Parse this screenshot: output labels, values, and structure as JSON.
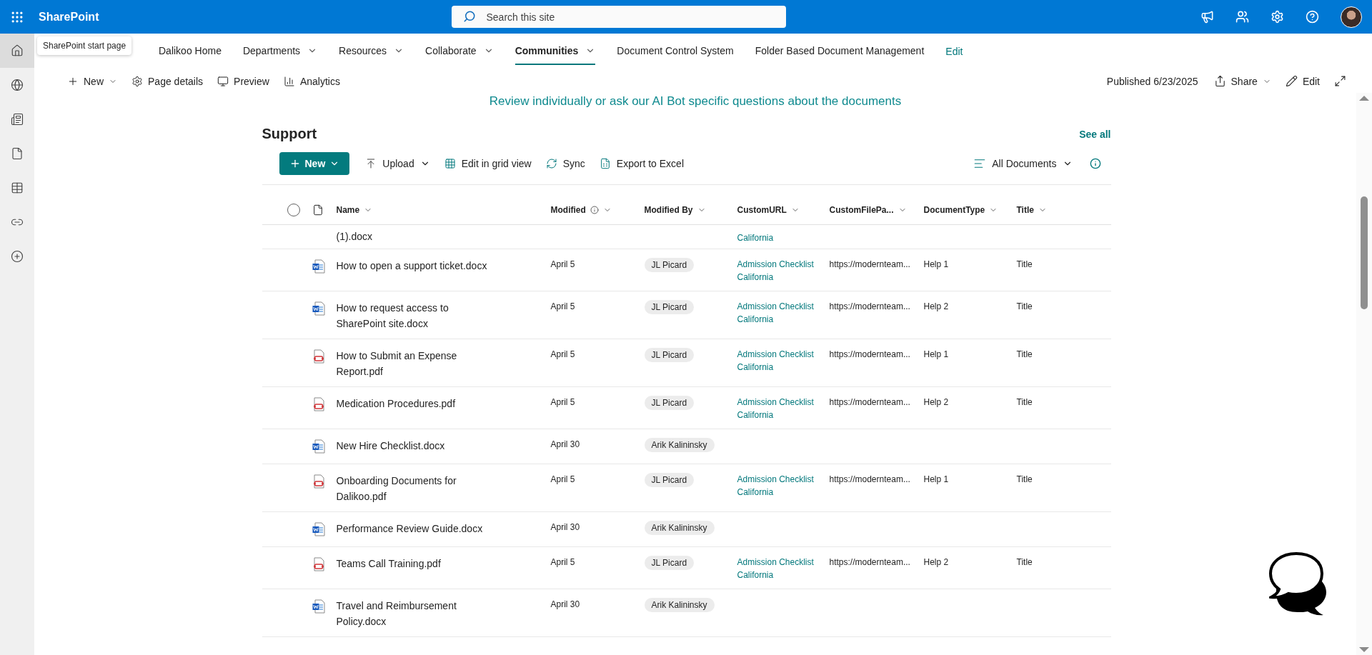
{
  "app_bar": {
    "title": "SharePoint",
    "search": {
      "placeholder": "Search this site"
    },
    "actions": [
      {
        "kind": "megaphone"
      },
      {
        "kind": "people"
      },
      {
        "kind": "settings"
      },
      {
        "kind": "help"
      },
      {
        "kind": "avatar"
      }
    ]
  },
  "left_rail": [
    {
      "kind": "home",
      "selected": true
    },
    {
      "kind": "globe",
      "selected": false
    },
    {
      "kind": "news",
      "selected": false
    },
    {
      "kind": "file",
      "selected": false
    },
    {
      "kind": "list",
      "selected": false
    },
    {
      "kind": "loop",
      "selected": false
    },
    {
      "kind": "create",
      "selected": false
    }
  ],
  "tooltip": "SharePoint start page",
  "site_nav": {
    "items": [
      {
        "label": "Dalikoo Home",
        "selected": false,
        "has_menu": false
      },
      {
        "label": "Departments",
        "selected": false,
        "has_menu": true
      },
      {
        "label": "Resources",
        "selected": false,
        "has_menu": true
      },
      {
        "label": "Collaborate",
        "selected": false,
        "has_menu": true
      },
      {
        "label": "Communities",
        "selected": true,
        "has_menu": true
      },
      {
        "label": "Document Control System",
        "selected": false,
        "has_menu": false
      },
      {
        "label": "Folder Based Document Management",
        "selected": false,
        "has_menu": false
      }
    ],
    "edit_link": "Edit"
  },
  "command_bar": {
    "left": [
      {
        "kind": "new",
        "label": "New",
        "has_menu": true
      },
      {
        "kind": "page-details",
        "label": "Page details",
        "has_menu": false
      },
      {
        "kind": "preview",
        "label": "Preview",
        "has_menu": false
      },
      {
        "kind": "analytics",
        "label": "Analytics",
        "has_menu": false
      }
    ],
    "published": "Published 6/23/2025",
    "right": [
      {
        "kind": "share",
        "label": "Share",
        "has_menu": true
      },
      {
        "kind": "edit",
        "label": "Edit",
        "has_menu": false
      },
      {
        "kind": "expand",
        "has_menu": false
      }
    ]
  },
  "tagline": "Review individually or ask our AI Bot specific questions about the documents",
  "library": {
    "title": "Support",
    "see_all": "See all",
    "new_button": "New",
    "actions": [
      {
        "kind": "upload",
        "label": "Upload",
        "has_menu": true
      },
      {
        "kind": "grid",
        "label": "Edit in grid view",
        "has_menu": false
      },
      {
        "kind": "sync",
        "label": "Sync",
        "has_menu": false
      },
      {
        "kind": "excel",
        "label": "Export to Excel",
        "has_menu": false
      }
    ],
    "view": "All Documents",
    "select_all": {
      "checked": false
    },
    "columns": [
      {
        "label": "Name",
        "info": false
      },
      {
        "label": "Modified",
        "info": true
      },
      {
        "label": "Modified By",
        "info": false
      },
      {
        "label": "CustomURL",
        "info": false
      },
      {
        "label": "CustomFilePa...",
        "info": false
      },
      {
        "label": "DocumentType",
        "info": false
      },
      {
        "label": "Title",
        "info": false
      }
    ],
    "rows": [
      {
        "name": "(1).docx",
        "custom_url": "California"
      },
      {
        "kind": "word",
        "name": "How to open a support ticket.docx",
        "modified": "April 5",
        "modified_by": "JL Picard",
        "custom_url": "Admission Checklist California",
        "custom_file_path": "https://modernteam...",
        "document_type": "Help 1",
        "title": "Title"
      },
      {
        "kind": "word",
        "name": "How to request access to SharePoint site.docx",
        "modified": "April 5",
        "modified_by": "JL Picard",
        "custom_url": "Admission Checklist California",
        "custom_file_path": "https://modernteam...",
        "document_type": "Help 2",
        "title": "Title"
      },
      {
        "kind": "pdf",
        "name": "How to Submit an Expense Report.pdf",
        "modified": "April 5",
        "modified_by": "JL Picard",
        "custom_url": "Admission Checklist California",
        "custom_file_path": "https://modernteam...",
        "document_type": "Help 1",
        "title": "Title"
      },
      {
        "kind": "pdf",
        "name": "Medication Procedures.pdf",
        "modified": "April 5",
        "modified_by": "JL Picard",
        "custom_url": "Admission Checklist California",
        "custom_file_path": "https://modernteam...",
        "document_type": "Help 2",
        "title": "Title"
      },
      {
        "kind": "word",
        "name": "New Hire Checklist.docx",
        "modified": "April 30",
        "modified_by": "Arik Kalininsky"
      },
      {
        "kind": "pdf",
        "name": "Onboarding Documents for Dalikoo.pdf",
        "modified": "April 5",
        "modified_by": "JL Picard",
        "custom_url": "Admission Checklist California",
        "custom_file_path": "https://modernteam...",
        "document_type": "Help 1",
        "title": "Title"
      },
      {
        "kind": "word",
        "name": "Performance Review Guide.docx",
        "modified": "April 30",
        "modified_by": "Arik Kalininsky"
      },
      {
        "kind": "pdf",
        "name": "Teams Call Training.pdf",
        "modified": "April 5",
        "modified_by": "JL Picard",
        "custom_url": "Admission Checklist California",
        "custom_file_path": "https://modernteam...",
        "document_type": "Help 2",
        "title": "Title"
      },
      {
        "kind": "word",
        "name": "Travel and Reimbursement Policy.docx",
        "modified": "April 30",
        "modified_by": "Arik Kalininsky"
      }
    ]
  }
}
